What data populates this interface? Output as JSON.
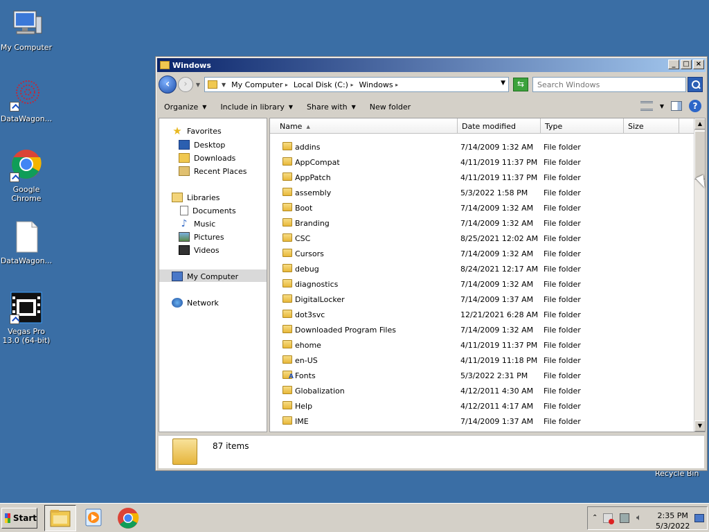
{
  "desktop": {
    "icons": [
      {
        "label": "My Computer"
      },
      {
        "label": "DataWagon..."
      },
      {
        "label": "Google Chrome"
      },
      {
        "label": "DataWagon..."
      },
      {
        "label": "Vegas Pro 13.0 (64-bit)"
      }
    ],
    "recycle_bin_label": "Recycle Bin"
  },
  "window": {
    "title": "Windows",
    "controls": {
      "minimize": "_",
      "maximize": "□",
      "close": "×"
    },
    "breadcrumbs": [
      "My Computer",
      "Local Disk (C:)",
      "Windows"
    ],
    "search_placeholder": "Search Windows",
    "commands": [
      "Organize",
      "Include in library",
      "Share with",
      "New folder"
    ],
    "help_label": "?",
    "nav": {
      "favorites": "Favorites",
      "favorite_items": [
        "Desktop",
        "Downloads",
        "Recent Places"
      ],
      "libraries": "Libraries",
      "library_items": [
        "Documents",
        "Music",
        "Pictures",
        "Videos"
      ],
      "computer": "My Computer",
      "network": "Network"
    },
    "columns": {
      "name": "Name",
      "date": "Date modified",
      "type": "Type",
      "size": "Size"
    },
    "files": [
      {
        "name": "addins",
        "date": "7/14/2009 1:32 AM",
        "type": "File folder"
      },
      {
        "name": "AppCompat",
        "date": "4/11/2019 11:37 PM",
        "type": "File folder"
      },
      {
        "name": "AppPatch",
        "date": "4/11/2019 11:37 PM",
        "type": "File folder"
      },
      {
        "name": "assembly",
        "date": "5/3/2022 1:58 PM",
        "type": "File folder"
      },
      {
        "name": "Boot",
        "date": "7/14/2009 1:32 AM",
        "type": "File folder"
      },
      {
        "name": "Branding",
        "date": "7/14/2009 1:32 AM",
        "type": "File folder"
      },
      {
        "name": "CSC",
        "date": "8/25/2021 12:02 AM",
        "type": "File folder"
      },
      {
        "name": "Cursors",
        "date": "7/14/2009 1:32 AM",
        "type": "File folder"
      },
      {
        "name": "debug",
        "date": "8/24/2021 12:17 AM",
        "type": "File folder"
      },
      {
        "name": "diagnostics",
        "date": "7/14/2009 1:32 AM",
        "type": "File folder"
      },
      {
        "name": "DigitalLocker",
        "date": "7/14/2009 1:37 AM",
        "type": "File folder"
      },
      {
        "name": "dot3svc",
        "date": "12/21/2021 6:28 AM",
        "type": "File folder"
      },
      {
        "name": "Downloaded Program Files",
        "date": "7/14/2009 1:32 AM",
        "type": "File folder"
      },
      {
        "name": "ehome",
        "date": "4/11/2019 11:37 PM",
        "type": "File folder"
      },
      {
        "name": "en-US",
        "date": "4/11/2019 11:18 PM",
        "type": "File folder"
      },
      {
        "name": "Fonts",
        "date": "5/3/2022 2:31 PM",
        "type": "File folder"
      },
      {
        "name": "Globalization",
        "date": "4/12/2011 4:30 AM",
        "type": "File folder"
      },
      {
        "name": "Help",
        "date": "4/12/2011 4:17 AM",
        "type": "File folder"
      },
      {
        "name": "IME",
        "date": "7/14/2009 1:37 AM",
        "type": "File folder"
      }
    ],
    "item_count": "87 items"
  },
  "taskbar": {
    "start_label": "Start",
    "time": "2:35 PM",
    "date": "5/3/2022"
  }
}
